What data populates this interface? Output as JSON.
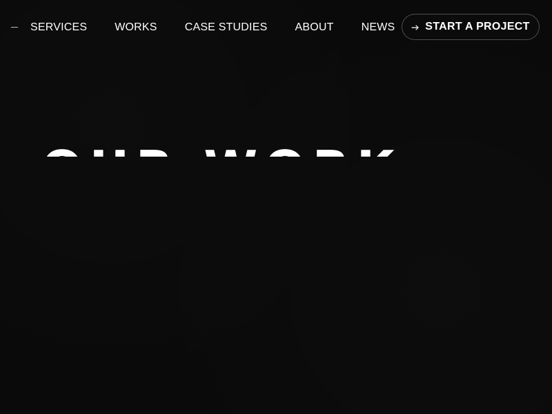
{
  "nav": {
    "menu_icon": "dash-icon",
    "items": [
      {
        "label": "SERVICES"
      },
      {
        "label": "WORKS"
      },
      {
        "label": "CASE STUDIES"
      },
      {
        "label": "ABOUT"
      },
      {
        "label": "NEWS"
      }
    ]
  },
  "cta": {
    "icon": "arrow-right-icon",
    "label": "START A PROJECT"
  },
  "hero": {
    "title": "OUR WORK"
  },
  "colors": {
    "background": "#0a0a0a",
    "text": "#ffffff",
    "border": "#3a3a3a"
  }
}
